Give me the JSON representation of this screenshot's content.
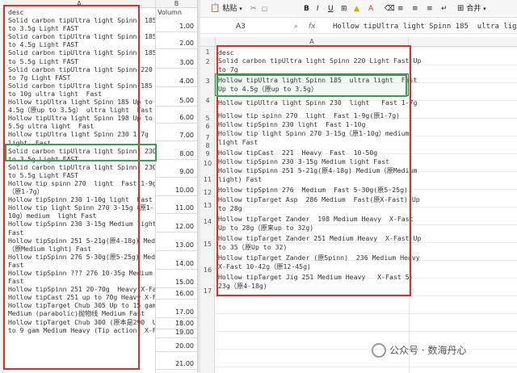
{
  "left_sheet": {
    "col_a_header": "A",
    "col_b_header": "B",
    "col_b_title": "Volumn",
    "lines": [
      "desc",
      "Solid carbon tipUltra light Spinn  185 Up",
      "to 3.5g Light FAST",
      "Solid carbon tipUltra light Spinn  185 Up",
      "to 4.5g Light FAST",
      "Solid carbon tipUltra light Spinn  185 Up",
      "to 5.5g Light FAST",
      "Solid carbon tipUltra light Spinn 220 Up",
      "to 7g Light FAST",
      "Solid carbon tipUltra light Spinn 185 Up",
      "to 10g ultra light  Fast",
      "Hollow tipUltra light Spinn 185 Up to",
      "4.5g（原up to 3.5g） ultra light  Fast",
      "Hollow tipUltra light Spinn 198 Up to",
      "5.5g ultra light  Fast",
      "Hollow tipUltra light Spinn 230 1-7g",
      "light  Fast",
      "Solid carbon tipUltra light Spinn  230 Up",
      "to 3.5g Light FAST",
      "Solid carbon tipUltra light Spinn  230 Up",
      "to 5.5g Light FAST",
      "Hollow tip spinn 270  light  Fast 1-9g",
      "（原1-7g）",
      "Hollow tipSpinn 230 1-10g light  Fast",
      "Hollow tip light Spinn 270 3-15g（原1-",
      "10g）medium  light Fast",
      "Hollow tipSpinn 230 3-15g Medium light",
      "Fast",
      "Hollow tipSpinn 251 5-21g(原4-18g) Medium",
      "（原Medium light) Fast",
      "Hollow tipSpinn 276 5-30g(原5-25g) Medium",
      "Fast",
      "Hollow tipSpinn ??? 276 10-35g Medium",
      "Fast",
      "Hollow tipSpinn 251 20-70g  Heavy X-Fast",
      "Hollow tipCast 251 up to 70g Heavy X-Fast",
      "Hollow tipTarget Chub 305 Up to 15 gam",
      "Medium (parabolic)抛物线 Medium Fast",
      "Hollow tipTarget Chub 300 (原本是290  Up",
      "to 9 gam Medium Heavy (Tip action) X-Fast"
    ],
    "volumes": [
      "1.00",
      "2.00",
      "3.00",
      "4.00",
      "5.00",
      "6.00",
      "7.00",
      "8.00",
      "9.00",
      "10.00",
      "11.00",
      "12.00",
      "13.00",
      "14.00",
      "15.00",
      "16.00",
      "17.00",
      "18.00",
      "19.00",
      "20.00",
      "21.00"
    ]
  },
  "right_window": {
    "ribbon": {
      "paste_label": "粘贴",
      "merge_label": "合并"
    },
    "name_box": "A3",
    "fx_symbol": "fx",
    "formula_content": "Hollow tipUltra light Spinn 185  ultra light  Fast",
    "col_header": "A",
    "row_numbers": [
      "1",
      "2",
      "3",
      "4",
      "5",
      "6",
      "7",
      "8",
      "9",
      "10",
      "11",
      "12",
      "13",
      "14",
      "15",
      "16",
      "17"
    ],
    "lines": [
      "desc",
      "Solid carbon tipUltra light Spinn 220 Light Fast Up",
      "to 7g",
      "Hollow tipUltra light Spinn 185  ultra light  Fast",
      "Up to 4.5g（原up to 3.5g）",
      "Hollow tipUltra light Spinn 230  light   Fast 1-7g",
      "Hollow tip spinn 270  light  Fast 1-9g(原1-7g)",
      "Hollow tipSpinn 230 light  Fast 1-10g",
      "Hollow tip light Spinn 270 3-15g（原1-10g）medium",
      "light Fast",
      "Hollow tipCast  221  Heavy  Fast  10-50g",
      "Hollow tipSpinn 230 3-15g Medium light Fast",
      "Hollow tipSpinn 251 5-21g(原4-18g) Medium（原Medium",
      "light) Fast",
      "Hollow tipSpinn 276  Medium  Fast 5-30g(原5-25g)",
      "Hollow tipTarget Asp  286 Medium  Fast(原X-Fast) Up",
      "to 28g",
      "Hollow tipTarget Zander  198 Medium Heavy  X-Fast",
      "Up to 28g（原来up to 32g)",
      "Hollow tipTarget Zander 251 Medium Heavy  X-Fast Up",
      "to 35（原Up to 32)",
      "Hollow tipTarget Zander (原Spinn)  236 Medium Heavy",
      "X-Fast 10-42g（原12-45g)",
      "Hollow tipTarget Jig 251 Medium Heavy   X-Fast 5-",
      "23g（原4-18g)"
    ]
  },
  "watermark": "公众号 · 数海丹心",
  "colors": {
    "red_box": "#e52a2a",
    "green_box": "#33a24a"
  }
}
